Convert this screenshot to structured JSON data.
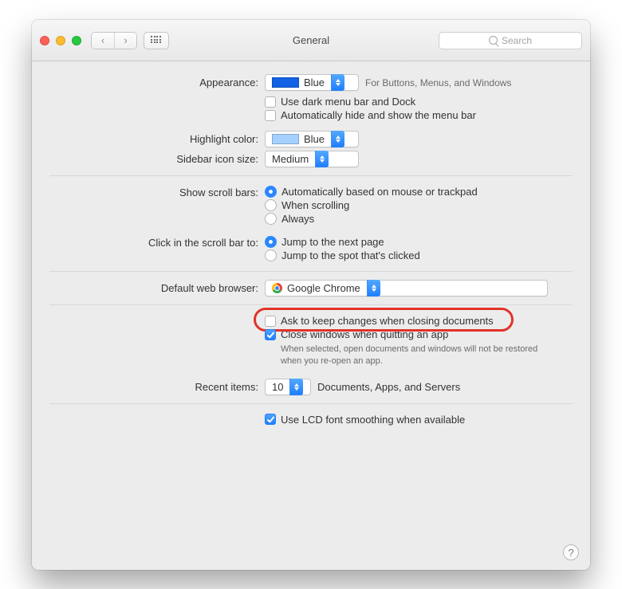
{
  "window": {
    "title": "General",
    "search_placeholder": "Search"
  },
  "appearance": {
    "label": "Appearance:",
    "value": "Blue",
    "hint": "For Buttons, Menus, and Windows",
    "darkmenu": "Use dark menu bar and Dock",
    "autohide": "Automatically hide and show the menu bar"
  },
  "highlight": {
    "label": "Highlight color:",
    "value": "Blue"
  },
  "sidebar": {
    "label": "Sidebar icon size:",
    "value": "Medium"
  },
  "scrollbars": {
    "label": "Show scroll bars:",
    "opt1": "Automatically based on mouse or trackpad",
    "opt2": "When scrolling",
    "opt3": "Always"
  },
  "clickscroll": {
    "label": "Click in the scroll bar to:",
    "opt1": "Jump to the next page",
    "opt2": "Jump to the spot that's clicked"
  },
  "browser": {
    "label": "Default web browser:",
    "value": "Google Chrome"
  },
  "docs": {
    "ask": "Ask to keep changes when closing documents",
    "close": "Close windows when quitting an app",
    "hint": "When selected, open documents and windows will not be restored when you re-open an app."
  },
  "recent": {
    "label": "Recent items:",
    "value": "10",
    "suffix": "Documents, Apps, and Servers"
  },
  "lcd": {
    "label": "Use LCD font smoothing when available"
  }
}
